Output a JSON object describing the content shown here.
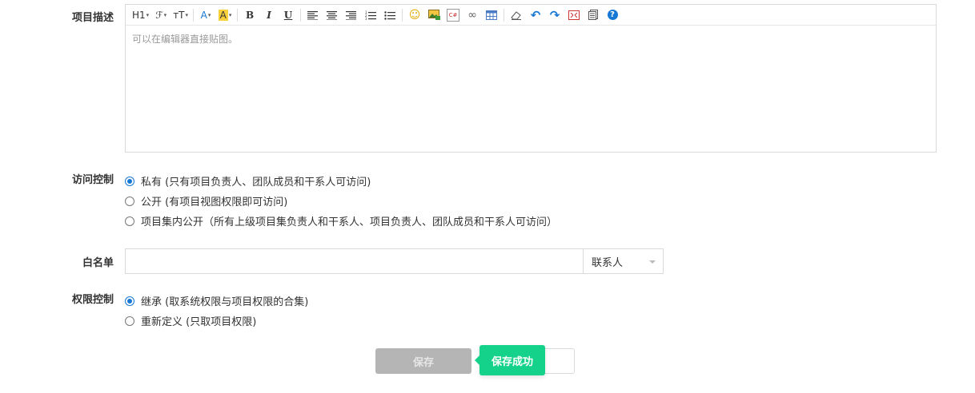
{
  "description": {
    "label": "项目描述",
    "placeholder": "可以在编辑器直接贴图。",
    "toolbar": [
      {
        "name": "heading-icon",
        "text": "H1",
        "caret": true
      },
      {
        "name": "font-family-icon",
        "text": "ℱ",
        "caret": true
      },
      {
        "name": "font-size-icon",
        "text": "ᴛT",
        "caret": true
      },
      {
        "name": "font-color-icon",
        "text": "A",
        "caret": true
      },
      {
        "name": "highlight-icon",
        "text": "A",
        "caret": true
      },
      {
        "name": "bold-icon",
        "text": "B"
      },
      {
        "name": "italic-icon",
        "text": "I"
      },
      {
        "name": "underline-icon",
        "text": "U"
      },
      {
        "name": "align-left-icon",
        "text": ""
      },
      {
        "name": "align-center-icon",
        "text": ""
      },
      {
        "name": "align-right-icon",
        "text": ""
      },
      {
        "name": "ordered-list-icon",
        "text": ""
      },
      {
        "name": "unordered-list-icon",
        "text": ""
      },
      {
        "name": "emoji-icon",
        "text": "☺"
      },
      {
        "name": "image-icon",
        "text": ""
      },
      {
        "name": "code-icon",
        "text": "C#"
      },
      {
        "name": "link-icon",
        "text": "∞"
      },
      {
        "name": "table-icon",
        "text": ""
      },
      {
        "name": "eraser-icon",
        "text": ""
      },
      {
        "name": "undo-icon",
        "text": "↶"
      },
      {
        "name": "redo-icon",
        "text": "↷"
      },
      {
        "name": "fullscreen-icon",
        "text": ""
      },
      {
        "name": "source-icon",
        "text": ""
      },
      {
        "name": "help-icon",
        "text": "?"
      }
    ]
  },
  "access": {
    "label": "访问控制",
    "options": [
      {
        "text": "私有 (只有项目负责人、团队成员和干系人可访问)",
        "checked": true
      },
      {
        "text": "公开 (有项目视图权限即可访问)",
        "checked": false
      },
      {
        "text": "项目集内公开（所有上级项目集负责人和干系人、项目负责人、团队成员和干系人可访问）",
        "checked": false
      }
    ]
  },
  "whitelist": {
    "label": "白名单",
    "value": "",
    "select_value": "联系人"
  },
  "permission": {
    "label": "权限控制",
    "options": [
      {
        "text": "继承 (取系统权限与项目权限的合集)",
        "checked": true
      },
      {
        "text": "重新定义 (只取项目权限)",
        "checked": false
      }
    ]
  },
  "actions": {
    "save_label": "保存",
    "toast": "保存成功"
  },
  "colors": {
    "accent": "#1677d4",
    "toast": "#15d28a",
    "save_disabled": "#b5b5b5"
  }
}
